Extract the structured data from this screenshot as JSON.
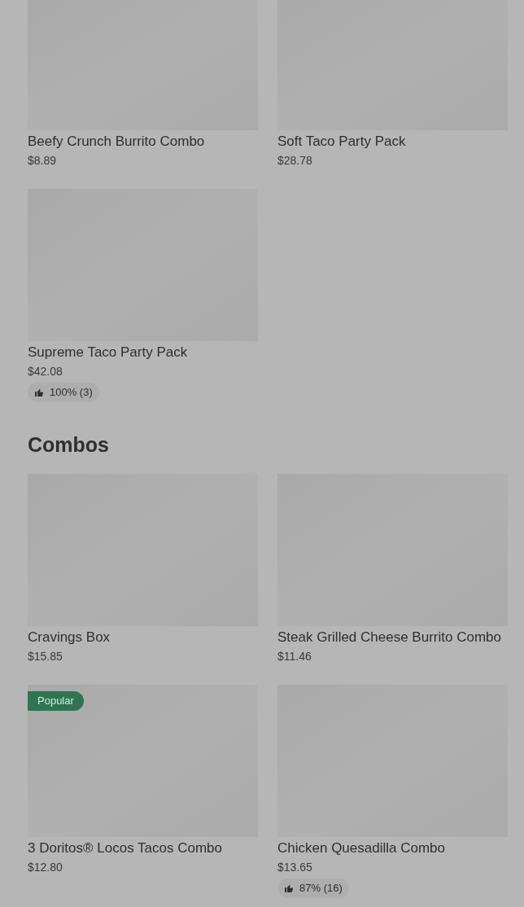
{
  "sections": [
    {
      "items": [
        {
          "name": "Beefy Crunch Burrito Combo",
          "price": "$8.89"
        },
        {
          "name": "Soft Taco Party Pack",
          "price": "$28.78"
        },
        {
          "name": "Supreme Taco Party Pack",
          "price": "$42.08",
          "rating": "100% (3)"
        }
      ]
    },
    {
      "title": "Combos",
      "items": [
        {
          "name": "Cravings Box",
          "price": "$15.85"
        },
        {
          "name": "Steak Grilled Cheese Burrito Combo",
          "price": "$11.46"
        },
        {
          "name": "3 Doritos® Locos Tacos Combo",
          "price": "$12.80",
          "badge": "Popular"
        },
        {
          "name": "Chicken Quesadilla Combo",
          "price": "$13.65",
          "rating": "87% (16)"
        }
      ]
    }
  ]
}
